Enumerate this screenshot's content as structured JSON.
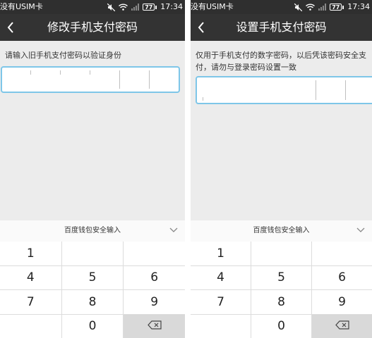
{
  "screens": [
    {
      "status": {
        "carrier": "没有USIM卡",
        "battery": "77",
        "time": "17:34"
      },
      "header": {
        "title": "修改手机支付密码"
      },
      "prompt": "请输入旧手机支付密码以验证身份",
      "keyboard": {
        "title": "百度钱包安全输入"
      }
    },
    {
      "status": {
        "carrier": "没有USIM卡",
        "battery": "77",
        "time": "17:34"
      },
      "header": {
        "title": "设置手机支付密码"
      },
      "prompt_lines": [
        "仅用于手机支付的数字密码，以后凭该密码安全支",
        "付，请勿与登录密码设置一致"
      ],
      "keyboard": {
        "title": "百度钱包安全输入"
      }
    }
  ],
  "keys": [
    "1",
    "",
    "",
    "4",
    "5",
    "6",
    "7",
    "8",
    "9",
    "",
    "0",
    "⌫"
  ],
  "icons": {
    "back": "chevron-left-icon",
    "collapse": "chevron-down-icon",
    "delete": "backspace-icon",
    "mute": "mute-icon",
    "wifi": "wifi-icon",
    "signal": "signal-icon"
  },
  "colors": {
    "header": "#333333",
    "statusbar": "#2f2f2f",
    "input_border": "#7ec6e8",
    "background": "#ececec"
  }
}
